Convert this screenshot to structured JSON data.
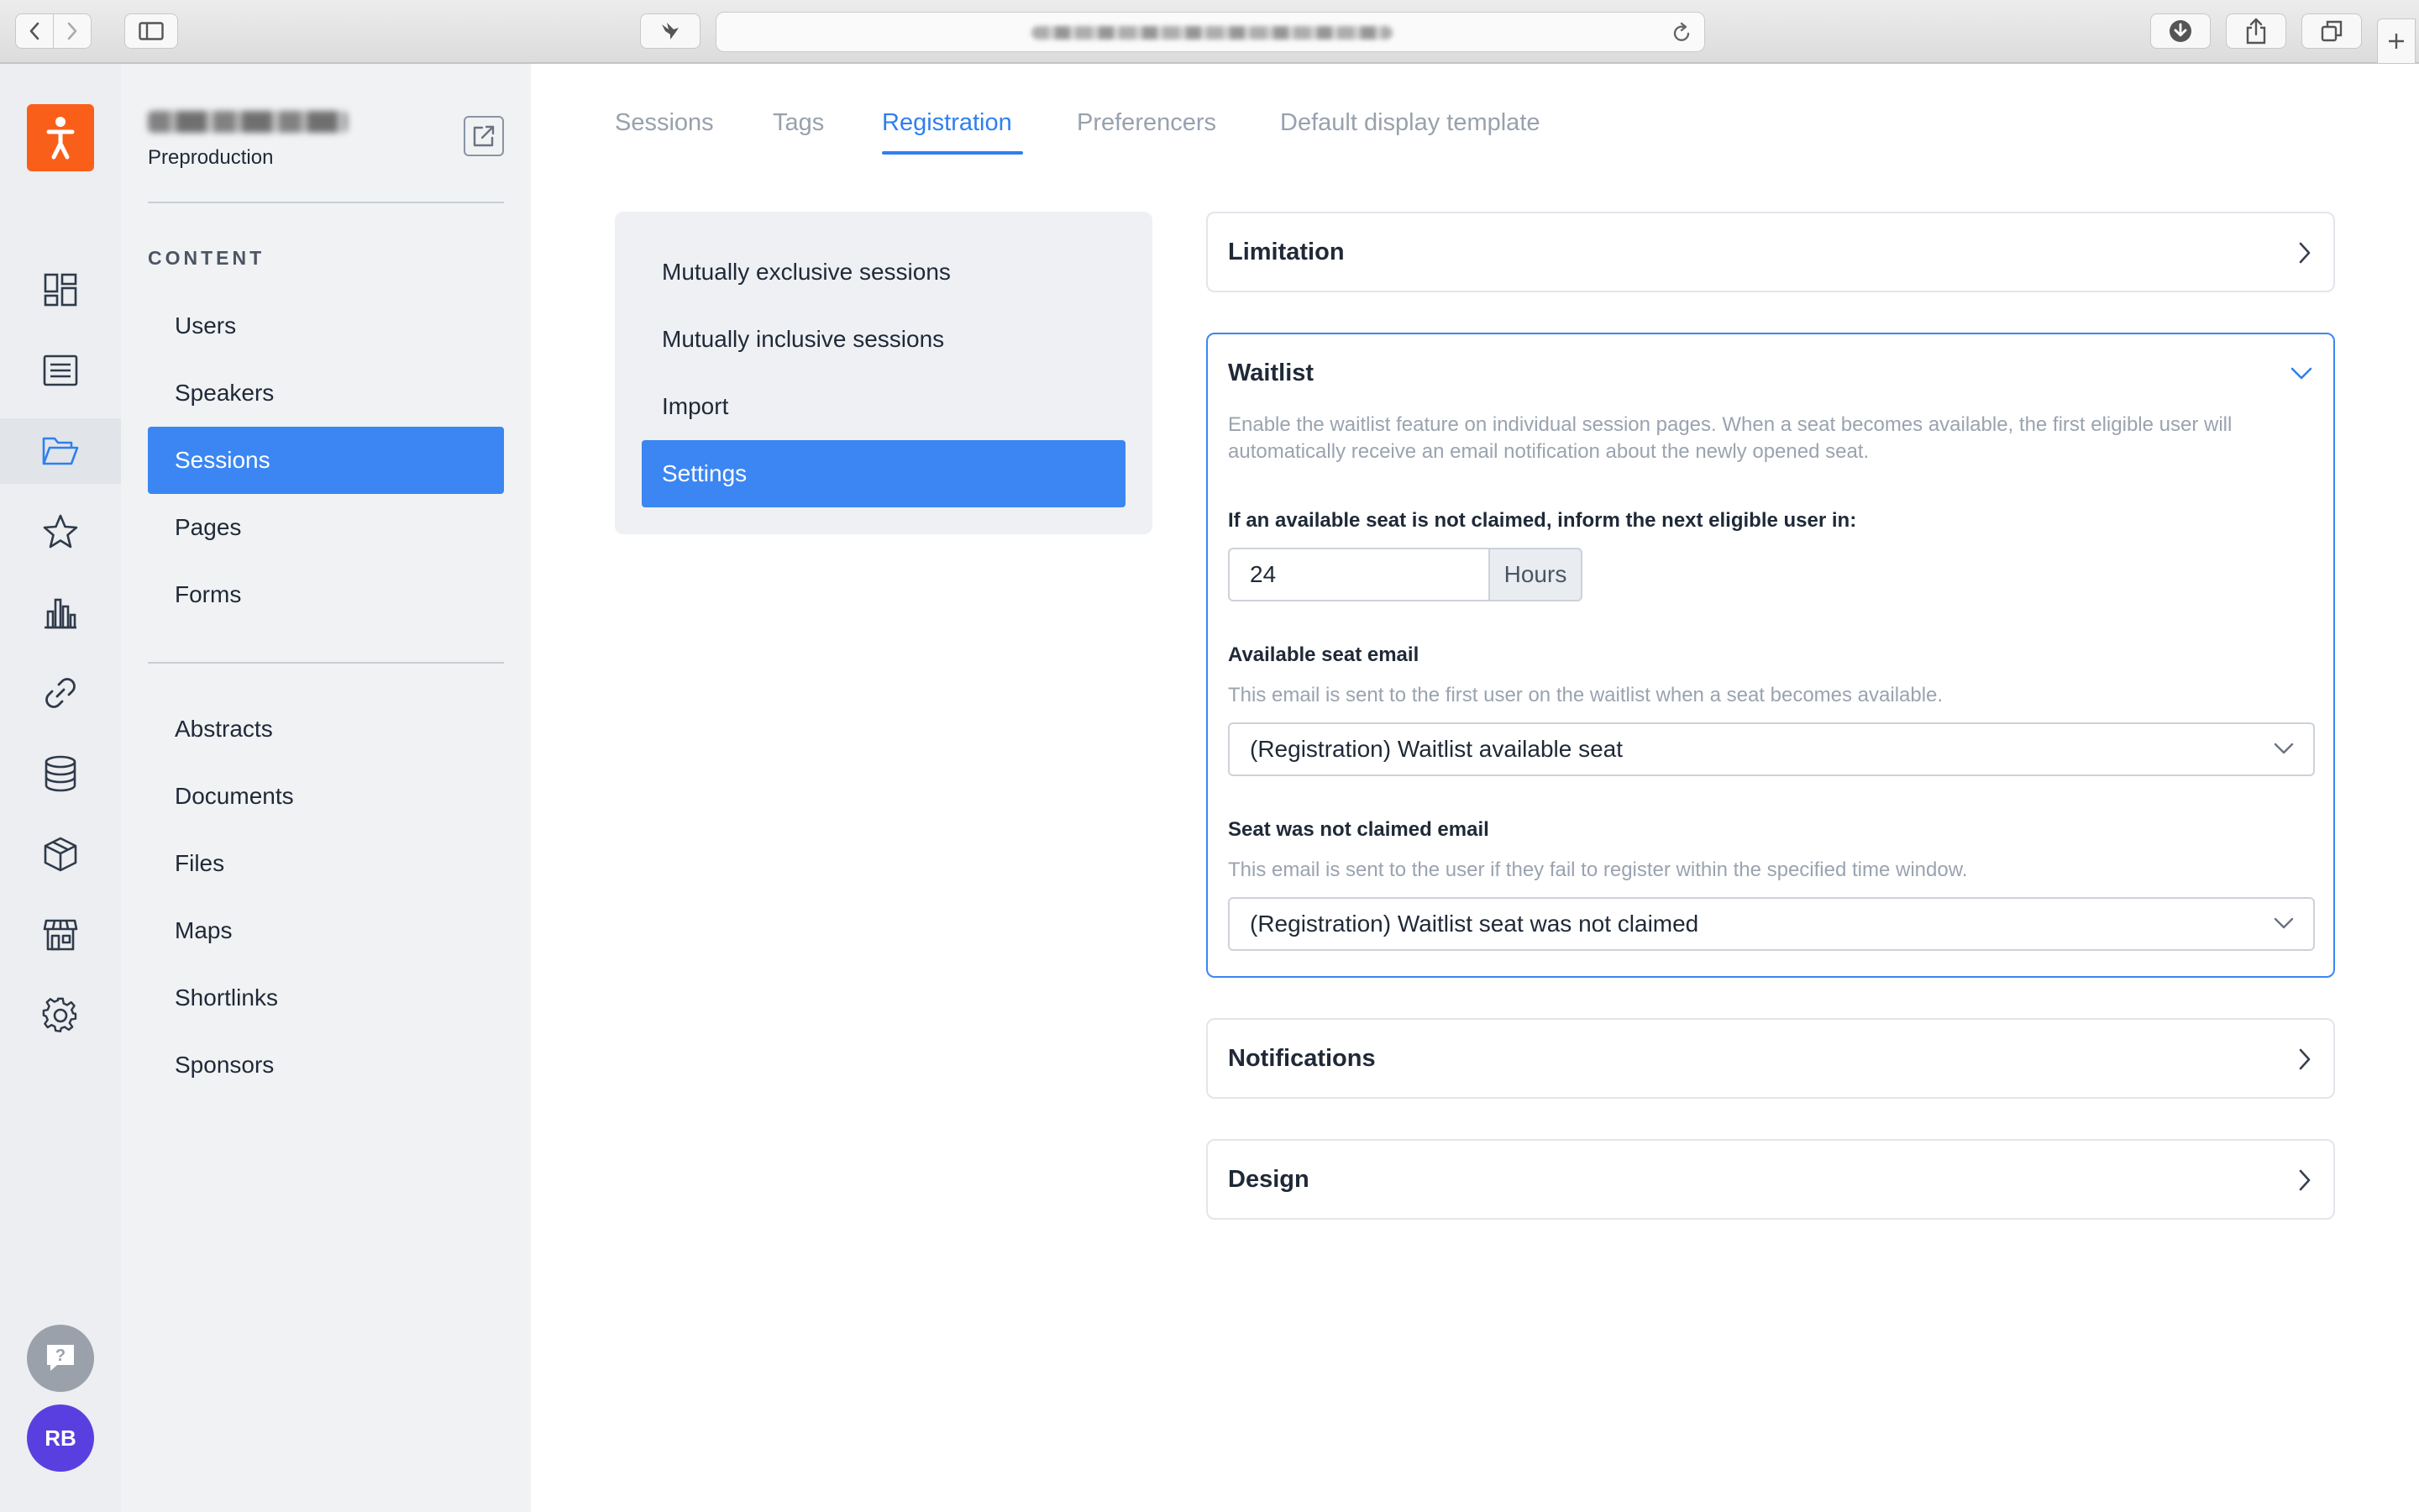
{
  "sidebar": {
    "environment": "Preproduction",
    "section_label": "CONTENT",
    "primary_items": [
      {
        "label": "Users"
      },
      {
        "label": "Speakers"
      },
      {
        "label": "Sessions",
        "active": true
      },
      {
        "label": "Pages"
      },
      {
        "label": "Forms"
      }
    ],
    "secondary_items": [
      {
        "label": "Abstracts"
      },
      {
        "label": "Documents"
      },
      {
        "label": "Files"
      },
      {
        "label": "Maps"
      },
      {
        "label": "Shortlinks"
      },
      {
        "label": "Sponsors"
      }
    ]
  },
  "rail": {
    "icons": [
      "dashboard-icon",
      "list-icon",
      "folder-icon",
      "star-icon",
      "bar-chart-icon",
      "link-icon",
      "database-icon",
      "box-icon",
      "store-icon",
      "gear-icon"
    ],
    "active_icon": "folder-icon",
    "avatar_initials": "RB"
  },
  "tabs": [
    {
      "label": "Sessions"
    },
    {
      "label": "Tags"
    },
    {
      "label": "Registration",
      "active": true
    },
    {
      "label": "Preferencers"
    },
    {
      "label": "Default display template"
    }
  ],
  "subnav": [
    {
      "label": "Mutually exclusive sessions"
    },
    {
      "label": "Mutually inclusive sessions"
    },
    {
      "label": "Import"
    },
    {
      "label": "Settings",
      "active": true
    }
  ],
  "panels": {
    "limitation": {
      "title": "Limitation"
    },
    "waitlist": {
      "title": "Waitlist",
      "description": "Enable the waitlist feature on individual session pages. When a seat becomes available, the first eligible user will automatically receive an email notification about the newly opened seat.",
      "inform_label": "If an available seat is not claimed, inform the next eligible user in:",
      "inform_value": "24",
      "inform_unit": "Hours",
      "available_seat_label": "Available seat email",
      "available_seat_help": "This email is sent to the first user on the waitlist when a seat becomes available.",
      "available_seat_value": "(Registration) Waitlist available seat",
      "not_claimed_label": "Seat was not claimed email",
      "not_claimed_help": "This email is sent to the user if they fail to register within the specified time window.",
      "not_claimed_value": "(Registration) Waitlist seat was not claimed"
    },
    "notifications": {
      "title": "Notifications"
    },
    "design": {
      "title": "Design"
    }
  },
  "colors": {
    "accent": "#3b86f2",
    "brand": "#fa5f1a",
    "avatar": "#5a3fe0"
  }
}
